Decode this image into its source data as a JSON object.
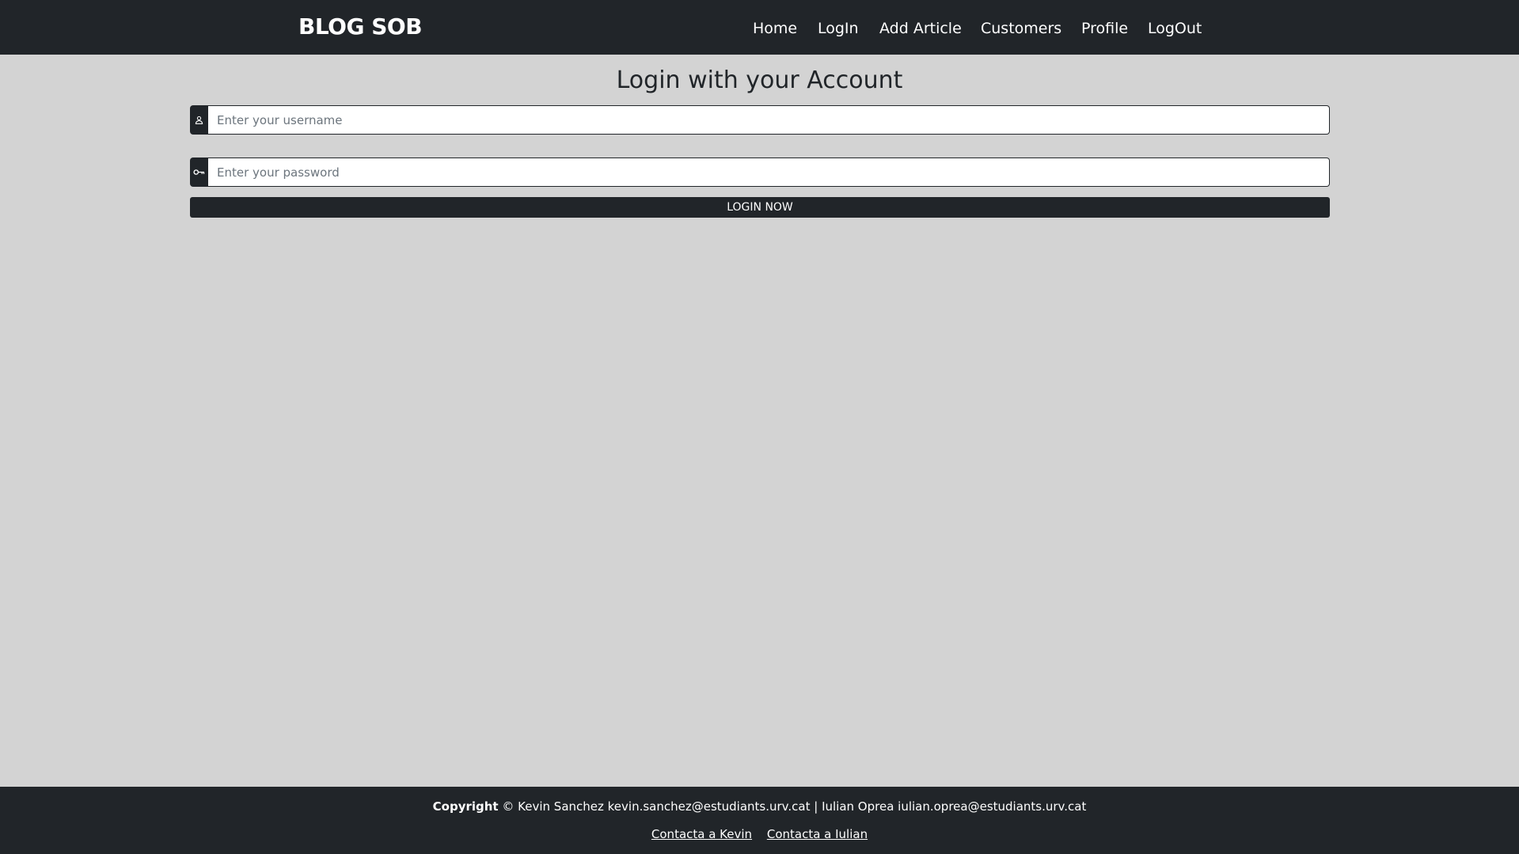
{
  "header": {
    "brand": "BLOG SOB",
    "nav": {
      "home": "Home",
      "login": "LogIn",
      "add_article": "Add Article",
      "customers": "Customers",
      "profile": "Profile",
      "logout": "LogOut"
    }
  },
  "main": {
    "title": "Login with your Account",
    "username": {
      "value": "",
      "placeholder": "Enter your username",
      "icon": "person-icon"
    },
    "password": {
      "value": "",
      "placeholder": "Enter your password",
      "icon": "key-icon"
    },
    "login_button": "LOGIN NOW"
  },
  "footer": {
    "copyright_label": "Copyright",
    "copyright_symbol": "©",
    "authors_text": "Kevin Sanchez kevin.sanchez@estudiants.urv.cat | Iulian Oprea iulian.oprea@estudiants.urv.cat",
    "links": [
      "Contacta a Kevin",
      "Contacta a Iulian"
    ]
  },
  "colors": {
    "header_bg": "#212529",
    "page_bg": "#d3d3d3",
    "text_light": "#ffffff",
    "text_dark": "#212529"
  }
}
